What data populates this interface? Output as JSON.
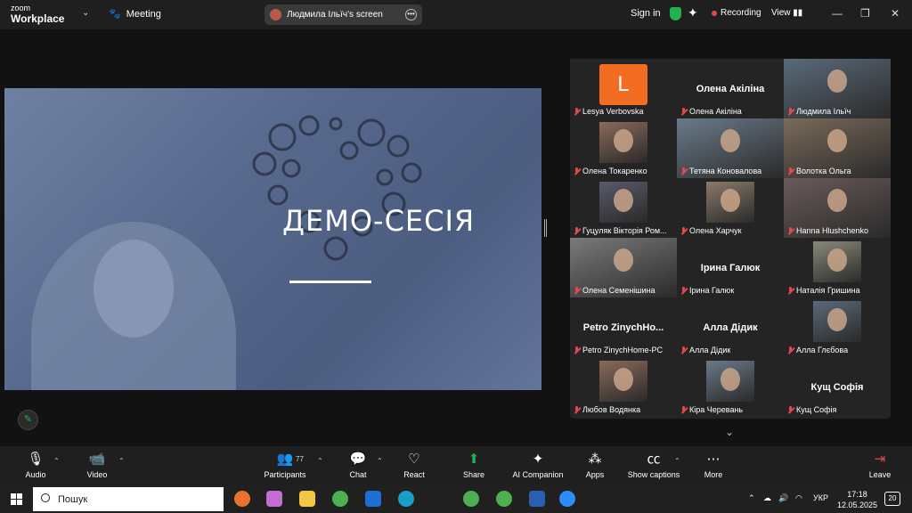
{
  "titlebar": {
    "logo_line1": "zoom",
    "logo_line2": "Workplace",
    "meeting_label": "Meeting",
    "share_label": "Людмила Ільїч's screen",
    "sign_in": "Sign in",
    "recording": "Recording",
    "view": "View"
  },
  "share": {
    "slide_title": "ДЕМО-СЕСІЯ"
  },
  "gallery": {
    "tiles": [
      {
        "name": "Lesya Verbovska",
        "avatar_letter": "L",
        "kind": "avatar"
      },
      {
        "name": "Олена Акіліна",
        "big_name": "Олена Акіліна",
        "kind": "name"
      },
      {
        "name": "Людмила Ільїч",
        "kind": "video",
        "active_speaker": true
      },
      {
        "name": "Олена Токаренко",
        "kind": "video"
      },
      {
        "name": "Тетяна Коновалова",
        "kind": "video"
      },
      {
        "name": "Волотка Ольга",
        "kind": "video"
      },
      {
        "name": "Гуцуляк Вікторія Ром...",
        "kind": "video"
      },
      {
        "name": "Олена Харчук",
        "kind": "video"
      },
      {
        "name": "Hanna Hlushchenko",
        "kind": "video"
      },
      {
        "name": "Олена Семенішина",
        "kind": "video"
      },
      {
        "name": "Ірина Галюк",
        "big_name": "Ірина Галюк",
        "kind": "name"
      },
      {
        "name": "Наталія Гришина",
        "kind": "video"
      },
      {
        "name": "Petro ZinychHome-PC",
        "big_name": "Petro ZinychHo...",
        "kind": "name"
      },
      {
        "name": "Алла Дідик",
        "big_name": "Алла Дідик",
        "kind": "name"
      },
      {
        "name": "Алла Глєбова",
        "kind": "video"
      },
      {
        "name": "Любов Водянка",
        "kind": "video"
      },
      {
        "name": "Кіра Черевань",
        "kind": "video"
      },
      {
        "name": "Кущ Софія",
        "big_name": "Кущ Софія",
        "kind": "name"
      }
    ]
  },
  "toolbar": {
    "audio": "Audio",
    "video": "Video",
    "participants": "Participants",
    "participants_count": "77",
    "chat": "Chat",
    "react": "React",
    "share": "Share",
    "ai_companion": "AI Companion",
    "apps": "Apps",
    "captions": "Show captions",
    "more": "More",
    "leave": "Leave"
  },
  "taskbar": {
    "search_placeholder": "Пошук",
    "language": "УКР",
    "time": "17:18",
    "date": "12.05.2025",
    "notifications": "20"
  },
  "colors": {
    "accent_green": "#22b14c",
    "record_red": "#e5484d",
    "avatar_orange": "#f26d21"
  }
}
